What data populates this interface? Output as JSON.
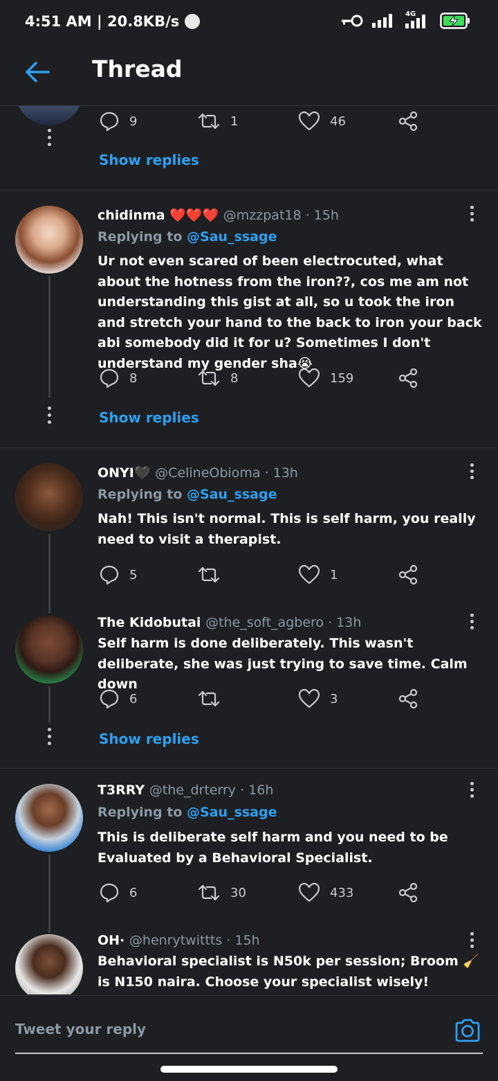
{
  "status_bar": {
    "time_speed": "4:51 AM | 20.8KB/s",
    "network_label": "4G",
    "accent": "#2ea0f0"
  },
  "header": {
    "title": "Thread",
    "back_icon": "arrow-left-icon"
  },
  "tweets": [
    {
      "id": "partial-top",
      "actions": {
        "replies": "9",
        "retweets": "1",
        "likes": "46"
      },
      "show_replies": "Show replies"
    },
    {
      "id": "chidinma",
      "name": "chidinma ❤️❤️❤️",
      "handle": "@mzzpat18 · 15h",
      "replying_prefix": "Replying to",
      "replying_to": "@Sau_ssage",
      "text": "Ur not even scared of been electrocuted, what about the hotness from the iron??, cos me am not understanding this gist at all, so u took the iron and stretch your hand to the back to iron your back abi somebody did it for u? Sometimes I don't understand my gender sha😭",
      "actions": {
        "replies": "8",
        "retweets": "8",
        "likes": "159"
      },
      "show_replies": "Show replies"
    },
    {
      "id": "onyi",
      "name": "ONYI🖤",
      "handle": "@CelineObioma · 13h",
      "replying_prefix": "Replying to",
      "replying_to": "@Sau_ssage",
      "text": "Nah! This isn't normal. This is self harm, you really need to visit a therapist.",
      "actions": {
        "replies": "5",
        "retweets": "",
        "likes": "1"
      }
    },
    {
      "id": "kidobutai",
      "name": "The Kidobutai",
      "handle": "@the_soft_agbero · 13h",
      "text": "Self harm is done deliberately. This wasn't deliberate, she was just trying to save time. Calm down",
      "actions": {
        "replies": "6",
        "retweets": "",
        "likes": "3"
      },
      "show_replies": "Show replies"
    },
    {
      "id": "terry",
      "name": "T3RRY",
      "handle": "@the_drterry · 16h",
      "replying_prefix": "Replying to",
      "replying_to": "@Sau_ssage",
      "text": "This is deliberate self harm and you need to be Evaluated by a Behavioral Specialist.",
      "actions": {
        "replies": "6",
        "retweets": "30",
        "likes": "433"
      }
    },
    {
      "id": "oh",
      "name": "OH·",
      "handle": "@henrytwittts · 15h",
      "text": "Behavioral specialist is N50k per session; Broom 🧹 is N150 naira. Choose your specialist wisely!"
    }
  ],
  "reply_bar": {
    "placeholder": "Tweet your reply",
    "camera_icon": "camera-icon"
  }
}
